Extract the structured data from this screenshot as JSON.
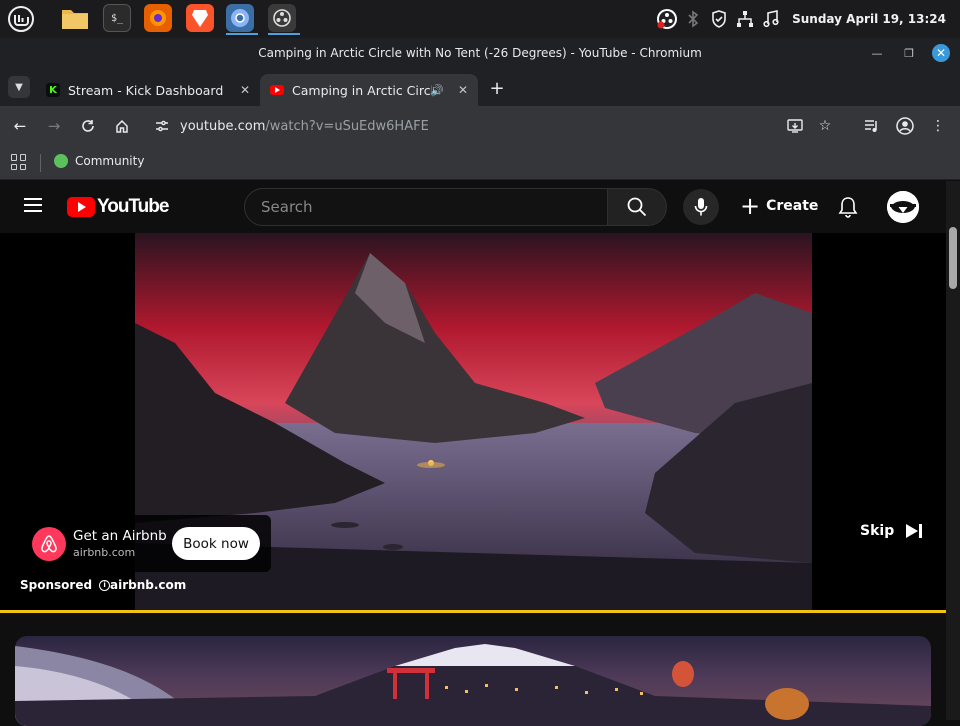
{
  "taskbar": {
    "apps": [
      {
        "name": "mint-menu",
        "icon": "mint-logo-icon"
      },
      {
        "name": "files",
        "icon": "folder-icon"
      },
      {
        "name": "terminal",
        "icon": "terminal-icon"
      },
      {
        "name": "firefox",
        "icon": "firefox-icon"
      },
      {
        "name": "brave",
        "icon": "brave-icon"
      },
      {
        "name": "chromium",
        "icon": "chromium-icon"
      },
      {
        "name": "obs",
        "icon": "obs-icon"
      }
    ],
    "clock": "Sunday April 19, 13:24"
  },
  "window": {
    "title": "Camping in Arctic Circle with No Tent (-26 Degrees) - YouTube - Chromium"
  },
  "tabs": [
    {
      "title": "Stream - Kick Dashboard",
      "favicon_letter": "K",
      "favicon_color": "#53fc18"
    },
    {
      "title": "Camping in Arctic Circle w",
      "favicon_color": "#ff0000"
    }
  ],
  "toolbar": {
    "url_host": "youtube.com",
    "url_path": "/watch?v=uSuEdw6HAFE"
  },
  "bookmarks": {
    "items": [
      {
        "label": "Community"
      }
    ]
  },
  "youtube": {
    "logo_text": "YouTube",
    "search_placeholder": "Search",
    "create_label": "Create"
  },
  "ad": {
    "title": "Get an Airbnb",
    "domain": "airbnb.com",
    "cta": "Book now",
    "sponsored": "Sponsored",
    "domain_footer": "airbnb.com",
    "skip": "Skip",
    "brand_color": "#ff385c"
  },
  "colors": {
    "progress": "#f2c311",
    "accent": "#ff0000"
  }
}
